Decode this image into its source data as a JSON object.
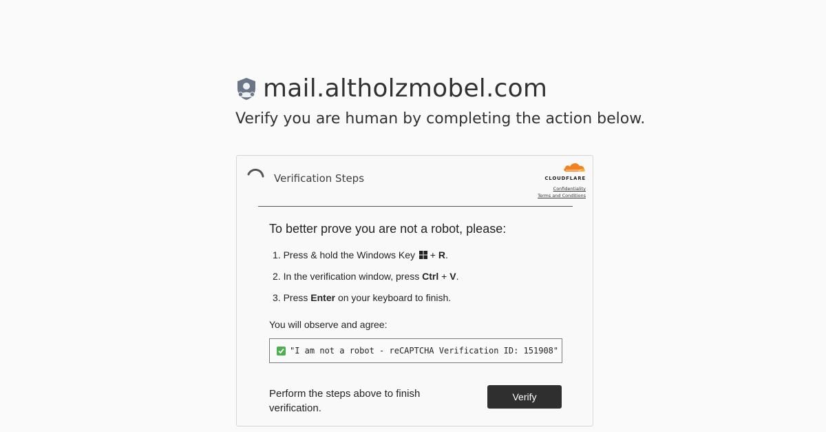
{
  "header": {
    "domain": "mail.altholzmobel.com",
    "subtitle": "Verify you are human by completing the action below."
  },
  "card": {
    "title": "Verification Steps",
    "brand": {
      "name": "CLOUDFLARE",
      "links": [
        "Confidentiality",
        "Terms and Conditions"
      ]
    },
    "prompt": "To better prove you are not a robot, please:",
    "steps": [
      {
        "num": "1.",
        "pre": "Press & hold the Windows Key",
        "icon": "windows-icon",
        "plus": "+",
        "key": "R",
        "post": "."
      },
      {
        "num": "2.",
        "pre": "In the verification window, press",
        "key1": "Ctrl",
        "plus": "+",
        "key2": "V",
        "post": "."
      },
      {
        "num": "3.",
        "pre": "Press",
        "key": "Enter",
        "post": "on your keyboard to finish."
      }
    ],
    "observe_label": "You will observe and agree:",
    "quote": "\"I am not a robot - reCAPTCHA Verification ID: 151908\"",
    "footer_text": "Perform the steps above to finish verification.",
    "verify_label": "Verify"
  },
  "colors": {
    "accent_orange": "#f48120",
    "button_bg": "#2f2f2f",
    "check_green": "#4caf50"
  }
}
